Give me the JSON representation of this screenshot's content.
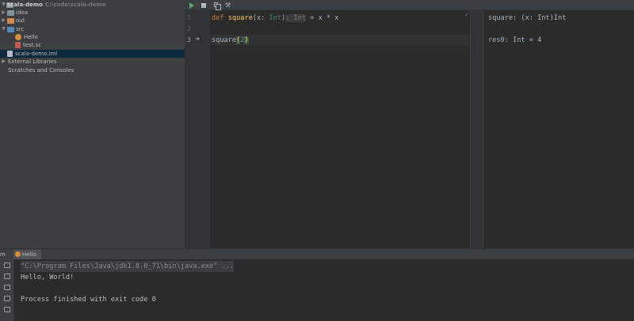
{
  "project_tree": {
    "root_label": "scala-demo",
    "root_path": "C:\\code\\scala-demo",
    "items": [
      {
        "label": "idea",
        "icon": "folder-icon"
      },
      {
        "label": "out",
        "icon": "folder-orange-icon"
      },
      {
        "label": "src",
        "icon": "source-folder-icon"
      },
      {
        "label": "Hello",
        "icon": "scala-object-icon"
      },
      {
        "label": "test.sc",
        "icon": "scala-worksheet-icon"
      },
      {
        "label": "scala-demo.iml",
        "icon": "module-file-icon"
      },
      {
        "label": "External Libraries",
        "icon": "library-icon"
      },
      {
        "label": "Scratches and Consoles",
        "icon": "scratch-icon"
      }
    ]
  },
  "toolbar": {
    "buttons": [
      {
        "name": "run-icon",
        "color": "#59a869"
      },
      {
        "name": "trash-icon"
      },
      {
        "name": "copy-icon"
      },
      {
        "name": "wrench-icon"
      }
    ]
  },
  "editor": {
    "line_numbers": [
      "1",
      "2",
      "3"
    ],
    "line1": {
      "kw": "def",
      "fn": "square",
      "open": "(x: ",
      "param_type": "Int",
      "close": ")",
      "type_hint": ": Int",
      "rest": " = x * x"
    },
    "line3": {
      "fn": "square",
      "open": "(",
      "arg": "2",
      "close": ")"
    }
  },
  "output": {
    "lines": [
      "square: (x: Int)Int",
      "res0: Int = 4"
    ]
  },
  "run_panel": {
    "title": "m",
    "tab_label": "Hello",
    "console_lines": [
      "\"C:\\Program Files\\Java\\jdk1.8.0_71\\bin\\java.exe\" ...",
      "Hello, World!",
      "",
      "Process finished with exit code 0"
    ]
  },
  "colors": {
    "keyword": "#cc7832",
    "function": "#ffc66d",
    "number": "#6897bb",
    "background": "#2b2b2b",
    "panel": "#3c3f41"
  }
}
